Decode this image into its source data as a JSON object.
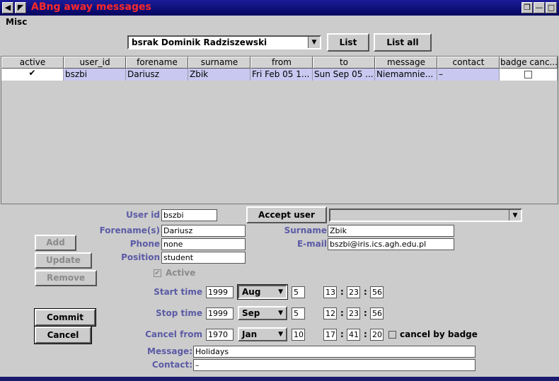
{
  "window": {
    "title": "ABng away messages"
  },
  "menu": {
    "misc": "Misc"
  },
  "toolbar": {
    "user_select": "bsrak Dominik Radziszewski",
    "list_label": "List",
    "list_all_label": "List all"
  },
  "table": {
    "headers": [
      "active",
      "user_id",
      "forename",
      "surname",
      "from",
      "to",
      "message",
      "contact",
      "badge canc..."
    ],
    "rows": [
      {
        "active": "✔",
        "user_id": "bszbi",
        "forename": "Dariusz",
        "surname": "Zbik",
        "from": "Fri Feb 05 1...",
        "to": "Sun Sep 05 ...",
        "message": "Niemamnie...",
        "contact": "–",
        "badge_cancel": ""
      }
    ]
  },
  "form": {
    "user_id_label": "User id",
    "user_id": "bszbi",
    "accept_user_label": "Accept user",
    "forename_label": "Forename(s)",
    "forename": "Dariusz",
    "surname_label": "Surname",
    "surname": "Zbik",
    "phone_label": "Phone",
    "phone": "none",
    "email_label": "E-mail",
    "email": "bszbi@iris.ics.agh.edu.pl",
    "position_label": "Position",
    "position": "student",
    "active_label": "Active",
    "active_check": "✔",
    "start_label": "Start time",
    "start_year": "1999",
    "start_month": "Aug",
    "start_day": "5",
    "start_h": "13",
    "start_m": "23",
    "start_s": "56",
    "stop_label": "Stop time",
    "stop_year": "1999",
    "stop_month": "Sep",
    "stop_day": "5",
    "stop_h": "12",
    "stop_m": "23",
    "stop_s": "56",
    "cancel_label": "Cancel from",
    "cancel_year": "1970",
    "cancel_month": "Jan",
    "cancel_day": "10",
    "cancel_h": "17",
    "cancel_m": "41",
    "cancel_s": "20",
    "cancel_badge_label": "cancel by badge",
    "message_label": "Message:",
    "message": "Holidays",
    "contact_label": "Contact:",
    "contact": "–",
    "time_sep": ":"
  },
  "buttons": {
    "add": "Add",
    "update": "Update",
    "remove": "Remove",
    "commit": "Commit",
    "cancel": "Cancel"
  },
  "colors": {
    "titlebar": "#05055e",
    "title_text": "#ff2a2a",
    "label": "#5b5ba6",
    "selected_row": "#c8c8f0"
  }
}
